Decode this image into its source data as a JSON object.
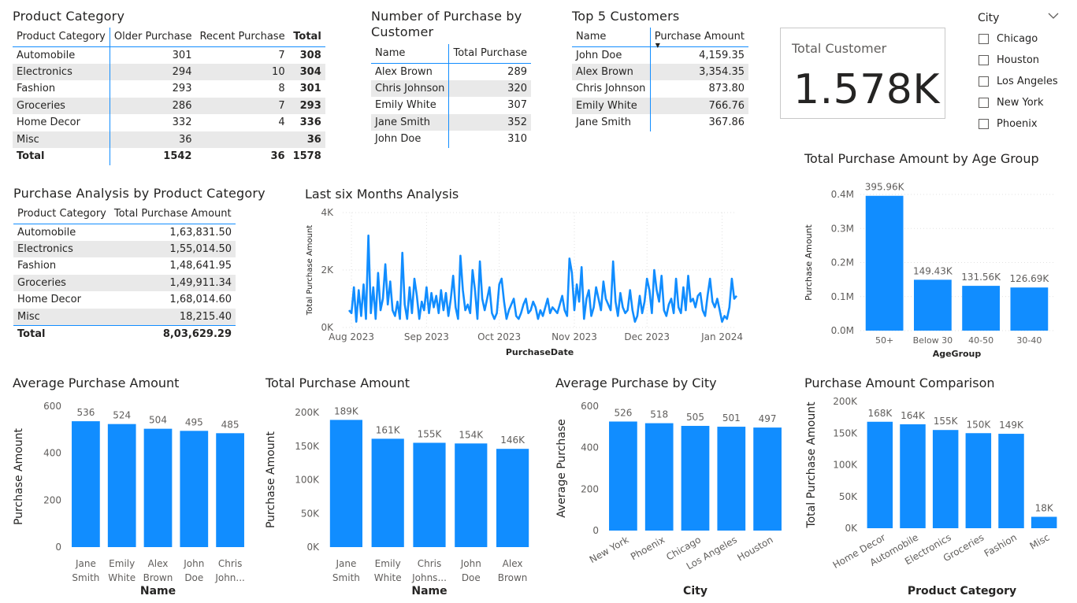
{
  "product_category_table": {
    "title": "Product Category",
    "headers": [
      "Product Category",
      "Older Purchase",
      "Recent Purchase",
      "Total"
    ],
    "rows": [
      [
        "Automobile",
        "301",
        "7",
        "308"
      ],
      [
        "Electronics",
        "294",
        "10",
        "304"
      ],
      [
        "Fashion",
        "293",
        "8",
        "301"
      ],
      [
        "Groceries",
        "286",
        "7",
        "293"
      ],
      [
        "Home Decor",
        "332",
        "4",
        "336"
      ],
      [
        "Misc",
        "36",
        "",
        "36"
      ]
    ],
    "total": [
      "Total",
      "1542",
      "36",
      "1578"
    ]
  },
  "purchase_by_customer_table": {
    "title_line1": "Number of Purchase by",
    "title_line2": "Customer",
    "headers": [
      "Name",
      "Total Purchase"
    ],
    "rows": [
      [
        "Alex Brown",
        "289"
      ],
      [
        "Chris Johnson",
        "320"
      ],
      [
        "Emily White",
        "307"
      ],
      [
        "Jane Smith",
        "352"
      ],
      [
        "John Doe",
        "310"
      ]
    ]
  },
  "top5_table": {
    "title": "Top 5 Customers",
    "headers": [
      "Name",
      "Purchase Amount"
    ],
    "rows": [
      [
        "John Doe",
        "4,159.35"
      ],
      [
        "Alex Brown",
        "3,354.35"
      ],
      [
        "Chris Johnson",
        "873.80"
      ],
      [
        "Emily White",
        "766.76"
      ],
      [
        "Jane Smith",
        "367.86"
      ]
    ]
  },
  "total_customer_card": {
    "label": "Total Customer",
    "value": "1.578K"
  },
  "city_slicer": {
    "title": "City",
    "items": [
      "Chicago",
      "Houston",
      "Los Angeles",
      "New York",
      "Phoenix"
    ]
  },
  "analysis_table": {
    "title": "Purchase Analysis by Product Category",
    "headers": [
      "Product Category",
      "Total Purchase Amount"
    ],
    "rows": [
      [
        "Automobile",
        "1,63,831.50"
      ],
      [
        "Electronics",
        "1,55,014.50"
      ],
      [
        "Fashion",
        "1,48,641.95"
      ],
      [
        "Groceries",
        "1,49,911.34"
      ],
      [
        "Home Decor",
        "1,68,014.60"
      ],
      [
        "Misc",
        "18,215.40"
      ]
    ],
    "total": [
      "Total",
      "8,03,629.29"
    ]
  },
  "colors": {
    "bar": "#118dff",
    "accent_line": "#118dff",
    "grid": "#e1e1e1",
    "zebra": "#e9e9e9"
  },
  "chart_data": [
    {
      "id": "line",
      "type": "line",
      "title": "Last six Months Analysis",
      "xlabel": "PurchaseDate",
      "ylabel": "Total Purchase Amount",
      "x_ticks": [
        "Aug 2023",
        "Sep 2023",
        "Oct 2023",
        "Nov 2023",
        "Dec 2023",
        "Jan 2024"
      ],
      "y_ticks": [
        "0K",
        "2K",
        "4K"
      ],
      "ylim": [
        0,
        4000
      ],
      "x_start": "2023-07-31",
      "x_end": "2024-01-07",
      "grid": true,
      "series": [
        {
          "values": [
            600,
            500,
            1400,
            200,
            1300,
            400,
            1500,
            300,
            3200,
            500,
            1400,
            300,
            1900,
            600,
            1000,
            2200,
            800,
            1600,
            600,
            400,
            900,
            300,
            2600,
            800,
            300,
            1400,
            500,
            1700,
            1100,
            300,
            900,
            600,
            1400,
            500,
            1200,
            700,
            1100,
            500,
            1300,
            600,
            1200,
            400,
            1000,
            1800,
            700,
            300,
            2500,
            1300,
            600,
            800,
            500,
            2000,
            1300,
            300,
            2300,
            1000,
            600,
            1000,
            1400,
            500,
            300,
            500,
            1500,
            1700,
            900,
            300,
            600,
            800,
            1000,
            400,
            300,
            500,
            800,
            1000,
            500,
            600,
            900,
            700,
            300,
            600,
            400,
            700,
            1000,
            500,
            700,
            600,
            500,
            800,
            1100,
            600,
            400,
            2400,
            1900,
            600,
            1500,
            900,
            2100,
            300,
            1000,
            1300,
            400,
            700,
            1400,
            1000,
            600,
            1600,
            1000,
            800,
            600,
            2300,
            900,
            400,
            1200,
            700,
            500,
            600,
            1300,
            600,
            200,
            400,
            1100,
            500,
            900,
            1700,
            1300,
            500,
            2000,
            1300,
            900,
            1800,
            600,
            400,
            800,
            1000,
            500,
            1700,
            700,
            500,
            1400,
            600,
            1800,
            900,
            1000,
            700,
            1100,
            1200,
            600,
            400,
            1100,
            1700,
            900,
            700,
            1000,
            600,
            200,
            400,
            300,
            700,
            1700,
            1000,
            1100
          ]
        }
      ]
    },
    {
      "id": "age",
      "type": "bar",
      "title": "Total Purchase Amount by Age Group",
      "xlabel": "AgeGroup",
      "ylabel": "Purchase Amount",
      "categories": [
        "50+",
        "Below 30",
        "40-50",
        "30-40"
      ],
      "values": [
        395960,
        149430,
        131560,
        126690
      ],
      "labels": [
        "395.96K",
        "149.43K",
        "131.56K",
        "126.69K"
      ],
      "y_ticks": [
        "0.0M",
        "0.1M",
        "0.2M",
        "0.3M",
        "0.4M"
      ],
      "ylim": [
        0,
        400000
      ]
    },
    {
      "id": "avg",
      "type": "bar",
      "title": "Average Purchase Amount",
      "xlabel": "Name",
      "ylabel": "Purchase Amount",
      "categories": [
        [
          "Jane",
          "Smith"
        ],
        [
          "Emily",
          "White"
        ],
        [
          "Alex",
          "Brown"
        ],
        [
          "John",
          "Doe"
        ],
        [
          "Chris",
          "John..."
        ]
      ],
      "values": [
        536,
        524,
        504,
        495,
        485
      ],
      "labels": [
        "536",
        "524",
        "504",
        "495",
        "485"
      ],
      "y_ticks": [
        "0",
        "200",
        "400",
        "600"
      ],
      "ylim": [
        0,
        600
      ]
    },
    {
      "id": "total",
      "type": "bar",
      "title": "Total Purchase Amount",
      "xlabel": "Name",
      "ylabel": "Purchase Amount",
      "categories": [
        [
          "Jane",
          "Smith"
        ],
        [
          "Emily",
          "White"
        ],
        [
          "Chris",
          "Johns..."
        ],
        [
          "John",
          "Doe"
        ],
        [
          "Alex",
          "Brown"
        ]
      ],
      "values": [
        189000,
        161000,
        155000,
        154000,
        146000
      ],
      "labels": [
        "189K",
        "161K",
        "155K",
        "154K",
        "146K"
      ],
      "y_ticks": [
        "0K",
        "50K",
        "100K",
        "150K",
        "200K"
      ],
      "ylim": [
        0,
        200000
      ]
    },
    {
      "id": "city",
      "type": "bar",
      "title": "Average Purchase by City",
      "xlabel": "City",
      "ylabel": "Average Purchase",
      "categories": [
        "New York",
        "Phoenix",
        "Chicago",
        "Los Angeles",
        "Houston"
      ],
      "values": [
        526,
        518,
        505,
        501,
        497
      ],
      "labels": [
        "526",
        "518",
        "505",
        "501",
        "497"
      ],
      "y_ticks": [
        "0",
        "200",
        "400",
        "600"
      ],
      "ylim": [
        0,
        600
      ]
    },
    {
      "id": "comp",
      "type": "bar",
      "title": "Purchase Amount Comparison",
      "xlabel": "Product Category",
      "ylabel": "Total Purchase Amount",
      "categories": [
        "Home Decor",
        "Automobile",
        "Electronics",
        "Groceries",
        "Fashion",
        "Misc"
      ],
      "values": [
        168000,
        164000,
        155000,
        150000,
        149000,
        18000
      ],
      "labels": [
        "168K",
        "164K",
        "155K",
        "150K",
        "149K",
        "18K"
      ],
      "y_ticks": [
        "0K",
        "50K",
        "100K",
        "150K",
        "200K"
      ],
      "ylim": [
        0,
        200000
      ]
    }
  ]
}
